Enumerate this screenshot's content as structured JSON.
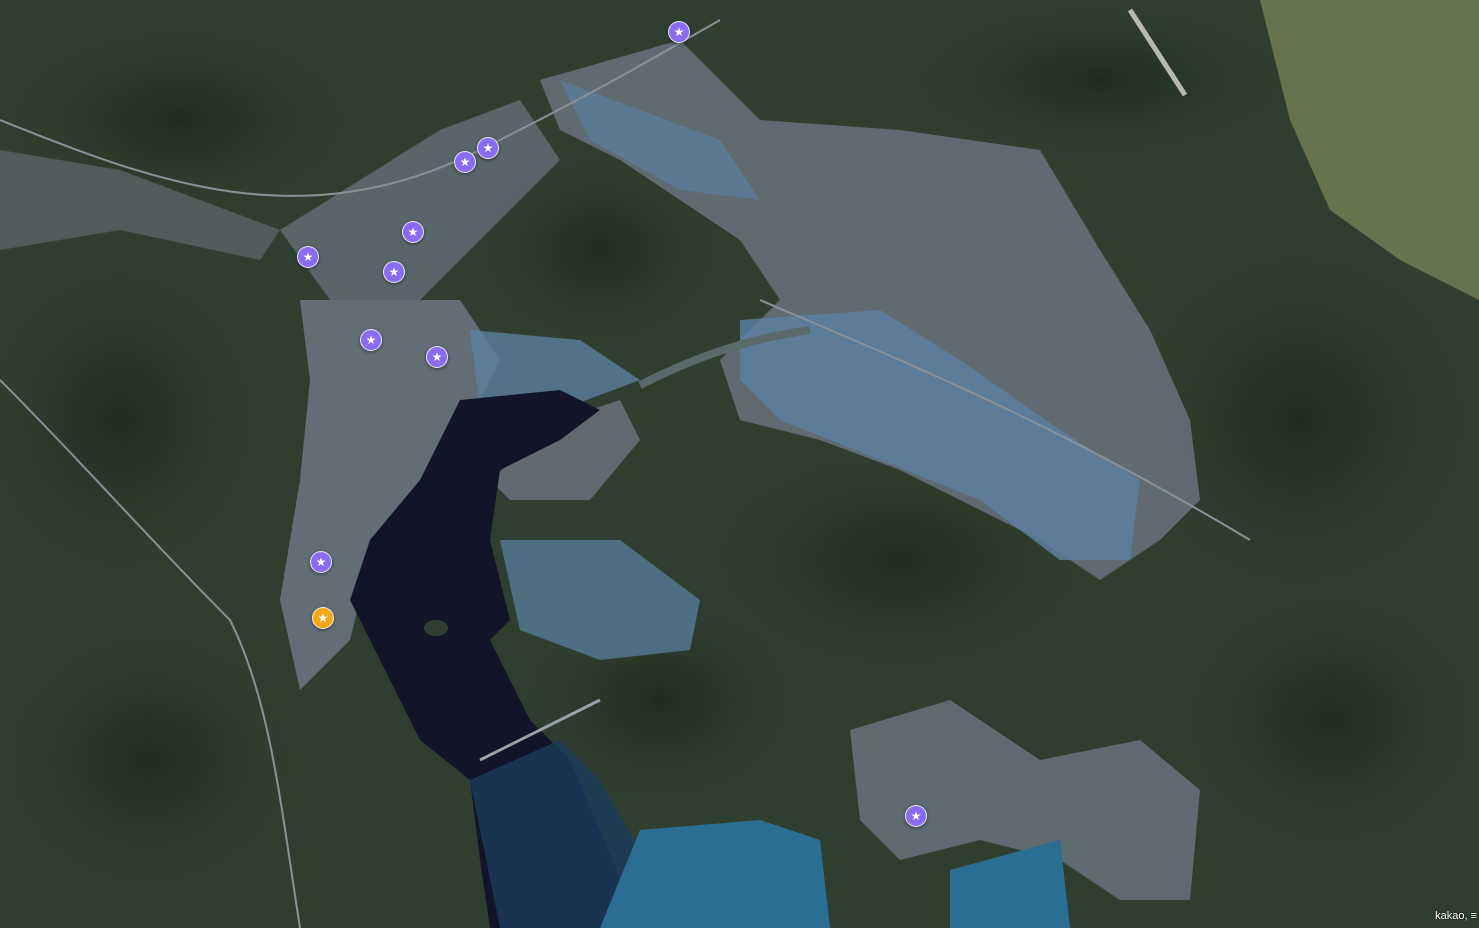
{
  "map": {
    "type": "satellite",
    "attribution": "kakao, ≡",
    "colors": {
      "forest": "#2f3f2f",
      "forest_dark": "#243224",
      "urban": "#6b7682",
      "industrial": "#5c7fa0",
      "bay_water": "#12152a",
      "sea": "#2a6f93",
      "farmland": "#6f7d55"
    }
  },
  "markers": [
    {
      "id": "marker-1",
      "color": "#8a6cf0",
      "icon": "star-icon"
    },
    {
      "id": "marker-2",
      "color": "#8a6cf0",
      "icon": "star-icon"
    },
    {
      "id": "marker-3",
      "color": "#8a6cf0",
      "icon": "star-icon"
    },
    {
      "id": "marker-4",
      "color": "#8a6cf0",
      "icon": "star-icon"
    },
    {
      "id": "marker-5",
      "color": "#8a6cf0",
      "icon": "star-icon"
    },
    {
      "id": "marker-6",
      "color": "#8a6cf0",
      "icon": "star-icon"
    },
    {
      "id": "marker-7",
      "color": "#8a6cf0",
      "icon": "star-icon"
    },
    {
      "id": "marker-8",
      "color": "#8a6cf0",
      "icon": "star-icon"
    },
    {
      "id": "marker-9",
      "color": "#8a6cf0",
      "icon": "star-icon"
    },
    {
      "id": "marker-10",
      "color": "#8a6cf0",
      "icon": "star-icon"
    },
    {
      "id": "marker-11",
      "color": "#f0a818",
      "icon": "star-icon"
    },
    {
      "id": "marker-12",
      "color": "#8a6cf0",
      "icon": "star-icon"
    }
  ]
}
